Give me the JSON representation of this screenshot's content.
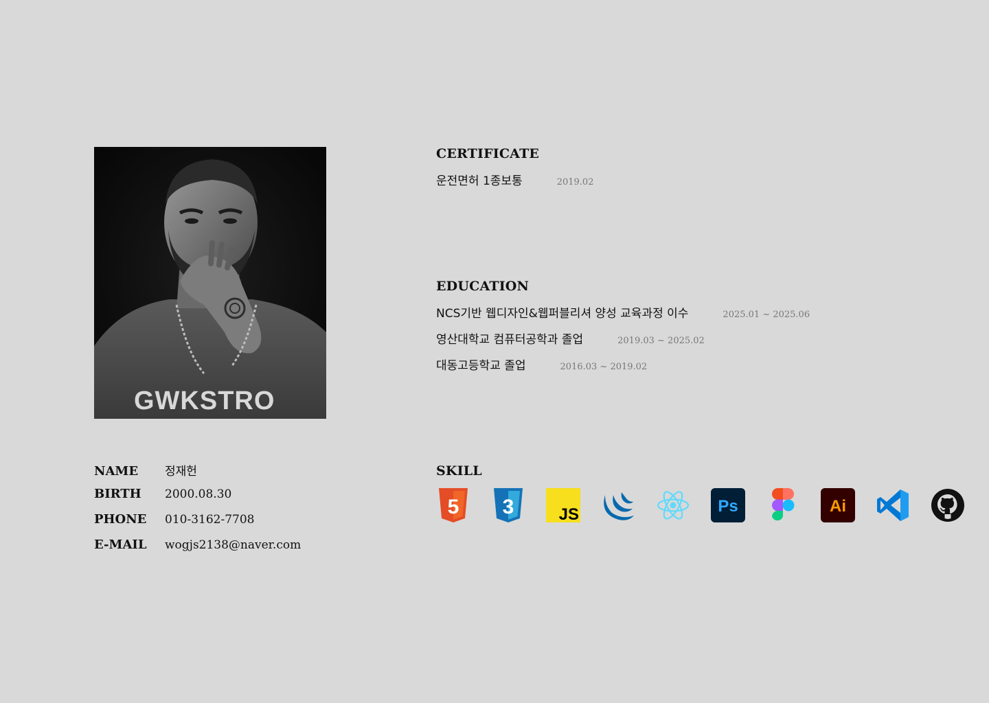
{
  "profile": {
    "photo_alt": "profile-photo",
    "rows": [
      {
        "label": "NAME",
        "value": "정재헌"
      },
      {
        "label": "BIRTH",
        "value": "2000.08.30"
      },
      {
        "label": "PHONE",
        "value": "010-3162-7708"
      },
      {
        "label": "E-MAIL",
        "value": "wogjs2138@naver.com"
      }
    ],
    "shirt_text": "GWKSTRO"
  },
  "certificate": {
    "title": "CERTIFICATE",
    "items": [
      {
        "text": "운전면허 1종보통",
        "date": "2019.02"
      }
    ]
  },
  "education": {
    "title": "EDUCATION",
    "items": [
      {
        "text": "NCS기반 웹디자인&웹퍼블리셔 양성 교육과정 이수",
        "date": "2025.01 ~ 2025.06"
      },
      {
        "text": "영산대학교 컴퓨터공학과 졸업",
        "date": "2019.03 ~ 2025.02"
      },
      {
        "text": "대동고등학교 졸업",
        "date": "2016.03 ~ 2019.02"
      }
    ]
  },
  "skill": {
    "title": "SKILL",
    "icons": [
      "html5-icon",
      "css3-icon",
      "javascript-icon",
      "jquery-icon",
      "react-icon",
      "photoshop-icon",
      "figma-icon",
      "illustrator-icon",
      "vscode-icon",
      "github-icon"
    ],
    "labels": {
      "html": "5",
      "css": "3",
      "js": "JS",
      "ps": "Ps",
      "ai": "Ai"
    }
  },
  "colors": {
    "background": "#d9d9d9",
    "html5": "#e44d26",
    "css3": "#1572b6",
    "javascript": "#f7df1e",
    "jquery": "#0769ad",
    "react": "#61dafb",
    "photoshop_bg": "#001e36",
    "photoshop_fg": "#31a8ff",
    "illustrator_bg": "#330000",
    "illustrator_fg": "#ff9a00",
    "vscode": "#0078d4"
  }
}
